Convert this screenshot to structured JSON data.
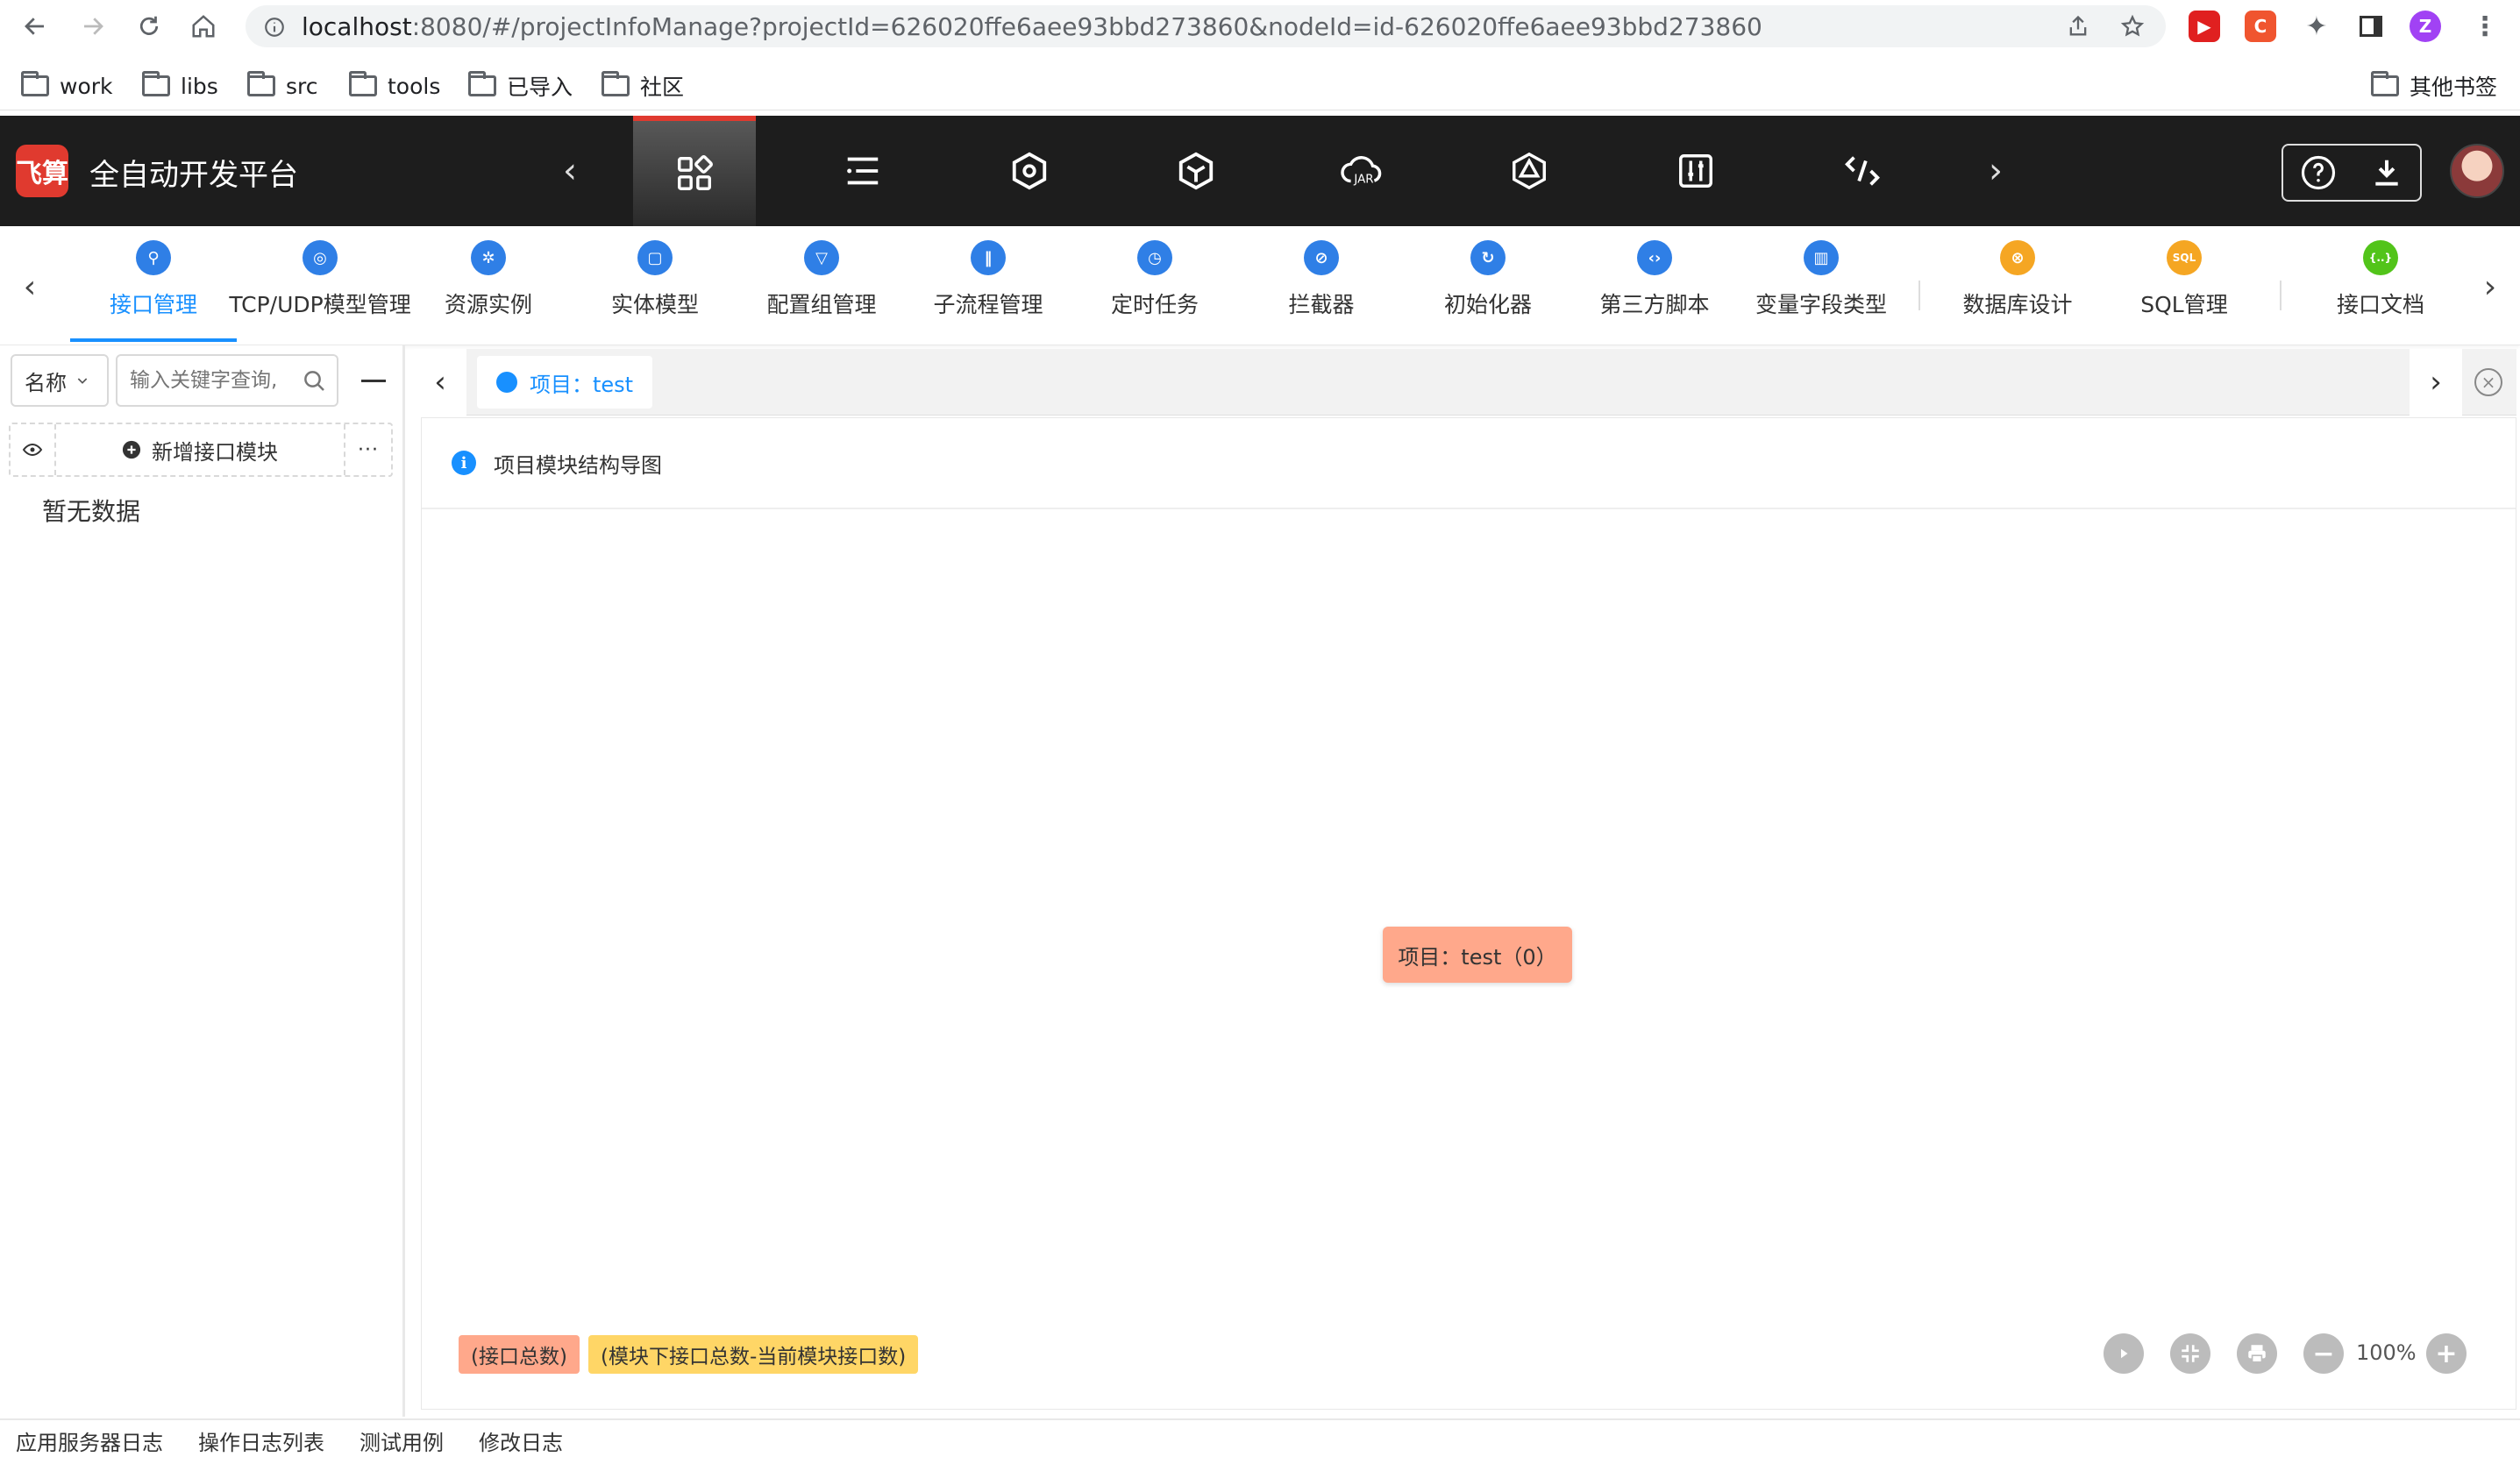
{
  "browser": {
    "url_host": "localhost",
    "url_path": ":8080/#/projectInfoManage?projectId=626020ffe6aee93bbd273860&nodeId=id-626020ffe6aee93bbd273860",
    "profile_initial": "Z",
    "bookmarks": [
      "work",
      "libs",
      "src",
      "tools",
      "已导入",
      "社区"
    ],
    "other_bookmarks": "其他书签"
  },
  "app": {
    "logo_text": "飞算",
    "title": "全自动开发平台"
  },
  "modules": [
    {
      "label": "接口管理",
      "color": "#2f7fe6",
      "icon": "link-icon"
    },
    {
      "label": "TCP/UDP模型管理",
      "color": "#2f7fe6",
      "icon": "globe-icon"
    },
    {
      "label": "资源实例",
      "color": "#2f7fe6",
      "icon": "gear-icon"
    },
    {
      "label": "实体模型",
      "color": "#2f7fe6",
      "icon": "frame-icon"
    },
    {
      "label": "配置组管理",
      "color": "#2f7fe6",
      "icon": "funnel-icon"
    },
    {
      "label": "子流程管理",
      "color": "#2f7fe6",
      "icon": "wave-icon"
    },
    {
      "label": "定时任务",
      "color": "#2f7fe6",
      "icon": "clock-icon"
    },
    {
      "label": "拦截器",
      "color": "#2f7fe6",
      "icon": "block-icon"
    },
    {
      "label": "初始化器",
      "color": "#2f7fe6",
      "icon": "refresh-icon"
    },
    {
      "label": "第三方脚本",
      "color": "#2f7fe6",
      "icon": "code-icon"
    },
    {
      "label": "变量字段类型",
      "color": "#2f7fe6",
      "icon": "bars-icon"
    },
    {
      "label": "数据库设计",
      "color": "#f5a623",
      "icon": "db-icon"
    },
    {
      "label": "SQL管理",
      "color": "#f5a623",
      "icon": "sql-icon",
      "badge": "SQL"
    },
    {
      "label": "接口文档",
      "color": "#52c41a",
      "icon": "braces-icon",
      "badge": "{..}"
    }
  ],
  "left": {
    "name_select": "名称",
    "search_placeholder": "输入关键字查询,",
    "add_module": "新增接口模块",
    "more": "···",
    "empty": "暂无数据"
  },
  "content": {
    "tab_label": "项目：test",
    "panel_title": "项目模块结构导图",
    "node_label": "项目：test（0）",
    "legend_total": "(接口总数)",
    "legend_module": "(模块下接口总数-当前模块接口数)",
    "zoom": "100%",
    "colors": {
      "node": "#ffa88b",
      "legend_module": "#ffd666"
    }
  },
  "footer": [
    "应用服务器日志",
    "操作日志列表",
    "测试用例",
    "修改日志"
  ]
}
